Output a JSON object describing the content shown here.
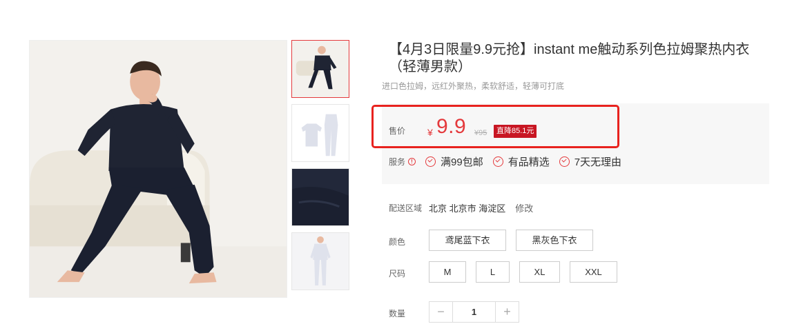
{
  "product": {
    "title": "【4月3日限量9.9元抢】instant me触动系列色拉姆聚热内衣（轻薄男款）",
    "subtitle": "进口色拉姆，远红外聚热，柔软舒适，轻薄可打底"
  },
  "price": {
    "label": "售价",
    "currency": "¥",
    "value": "9.9",
    "original": "¥95",
    "drop_badge": "直降85.1元"
  },
  "services": {
    "label": "服务",
    "info_icon": "info-circle-icon",
    "items": [
      "满99包邮",
      "有品精选",
      "7天无理由"
    ]
  },
  "delivery": {
    "label": "配送区域",
    "location": "北京 北京市 海淀区",
    "edit": "修改"
  },
  "color": {
    "label": "颜色",
    "options": [
      "鸢尾蓝下衣",
      "黑灰色下衣"
    ]
  },
  "size": {
    "label": "尺码",
    "options": [
      "M",
      "L",
      "XL",
      "XXL"
    ]
  },
  "quantity": {
    "label": "数量",
    "minus": "−",
    "value": "1",
    "plus": "+"
  },
  "colors": {
    "accent": "#e4393c",
    "badge": "#c81623",
    "highlight_border": "#e8221e",
    "panel_bg": "#f7f7f7"
  }
}
